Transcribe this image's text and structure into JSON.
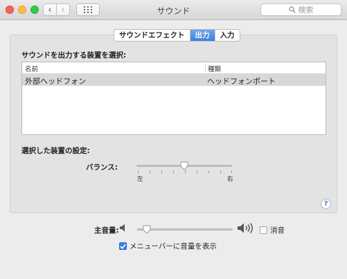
{
  "window": {
    "title": "サウンド"
  },
  "toolbar": {
    "search_placeholder": "検索"
  },
  "tabs": [
    {
      "label": "サウンドエフェクト",
      "active": false
    },
    {
      "label": "出力",
      "active": true
    },
    {
      "label": "入力",
      "active": false
    }
  ],
  "output": {
    "section_label": "サウンドを出力する装置を選択:",
    "columns": [
      "名前",
      "種類"
    ],
    "devices": [
      {
        "name": "外部ヘッドフォン",
        "type": "ヘッドフォンポート",
        "selected": true
      }
    ],
    "settings_label": "選択した装置の設定:",
    "balance": {
      "label": "バランス:",
      "left_label": "左",
      "right_label": "右",
      "value": 0.5
    }
  },
  "volume": {
    "label": "主音量:",
    "value": 0.1,
    "mute_label": "消音",
    "muted": false,
    "show_in_menubar_label": "メニューバーに音量を表示",
    "show_in_menubar": true
  },
  "help": {
    "label": "?"
  },
  "colors": {
    "accent": "#3c7fe0",
    "close": "#fc605c",
    "minimize": "#fdbc40",
    "maximize": "#34c84a"
  }
}
